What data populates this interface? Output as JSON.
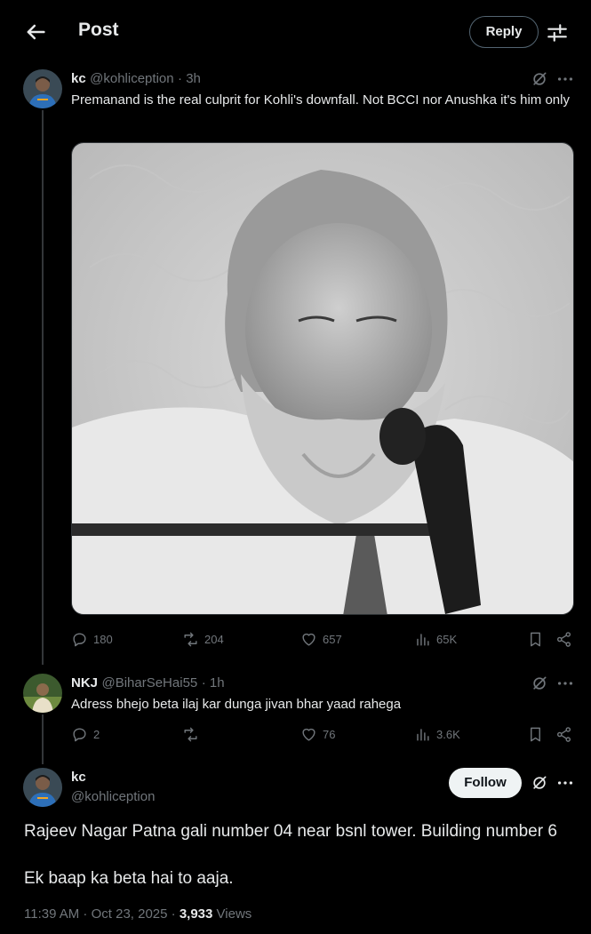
{
  "header": {
    "title": "Post",
    "reply_label": "Reply"
  },
  "thread": {
    "post": {
      "name": "kc",
      "handle": "@kohliception",
      "time": "· 3h",
      "text": "Premanand is the real culprit for Kohli's downfall. Not BCCI nor Anushka it's him only",
      "stats": {
        "replies": "180",
        "reposts": "204",
        "likes": "657",
        "views": "65K"
      }
    },
    "reply": {
      "name": "NKJ",
      "handle": "@BiharSeHai55",
      "time": "· 1h",
      "text": "Adress bhejo beta ilaj kar dunga jivan bhar yaad rahega",
      "stats": {
        "replies": "2",
        "reposts": "",
        "likes": "76",
        "views": "3.6K"
      }
    }
  },
  "focused": {
    "name": "kc",
    "handle": "@kohliception",
    "follow_label": "Follow",
    "line1": "Rajeev Nagar Patna gali number 04 near bsnl tower. Building number 6",
    "line2": "Ek baap ka beta hai to aaja.",
    "timestamp": "11:39 AM · Oct 23, 2025 · ",
    "views_count": "3,933",
    "views_label": " Views"
  },
  "icons": [
    "back-arrow-icon",
    "tune-icon",
    "grok-icon",
    "more-icon",
    "reply-icon",
    "repost-icon",
    "like-icon",
    "views-icon",
    "bookmark-icon",
    "share-icon"
  ]
}
